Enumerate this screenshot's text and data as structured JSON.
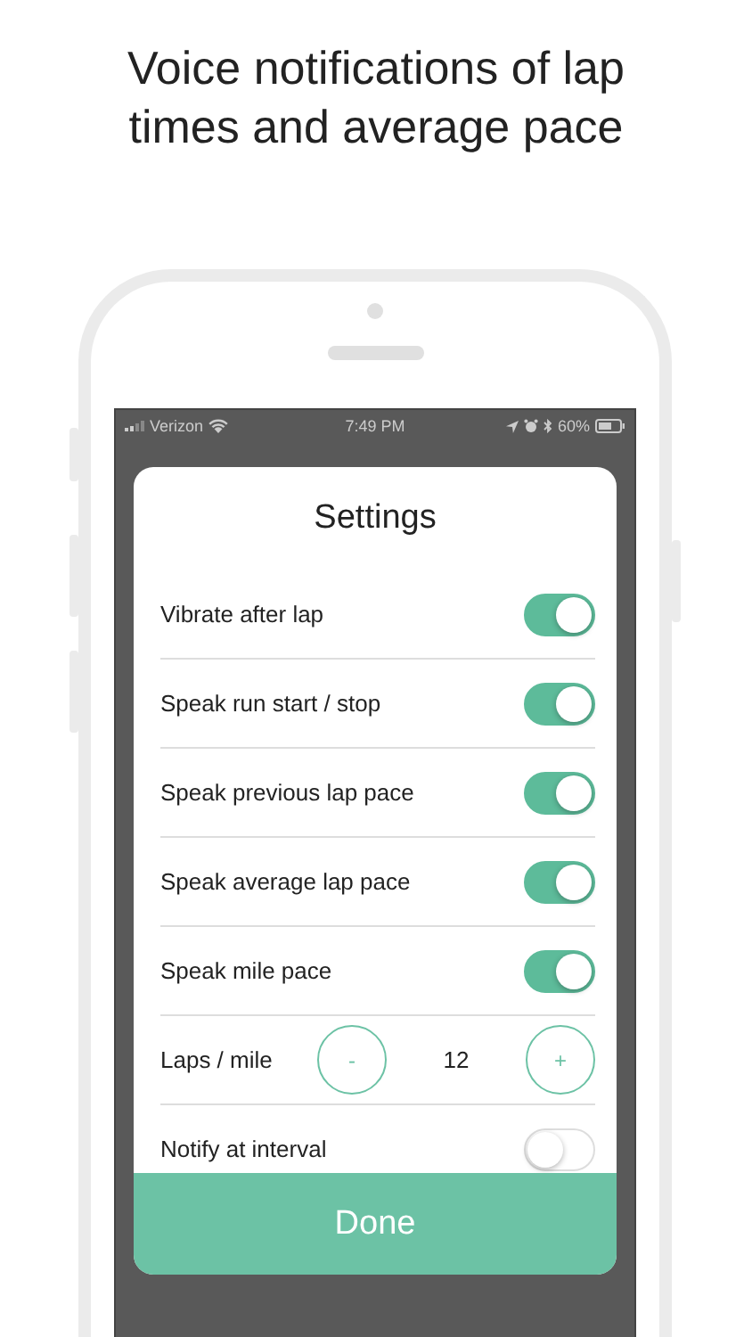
{
  "headline": "Voice notifications of lap times and average pace",
  "status_bar": {
    "carrier": "Verizon",
    "time": "7:49 PM",
    "battery": "60%"
  },
  "settings": {
    "title": "Settings",
    "rows": [
      {
        "kind": "toggle",
        "label": "Vibrate after lap",
        "on": true
      },
      {
        "kind": "toggle",
        "label": "Speak run start / stop",
        "on": true
      },
      {
        "kind": "toggle",
        "label": "Speak previous lap pace",
        "on": true
      },
      {
        "kind": "toggle",
        "label": "Speak average lap pace",
        "on": true
      },
      {
        "kind": "toggle",
        "label": "Speak mile pace",
        "on": true
      },
      {
        "kind": "stepper",
        "label": "Laps / mile",
        "decrement": "-",
        "value": "12",
        "increment": "+"
      },
      {
        "kind": "toggle",
        "label": "Notify at interval",
        "on": false
      }
    ],
    "done": "Done"
  }
}
